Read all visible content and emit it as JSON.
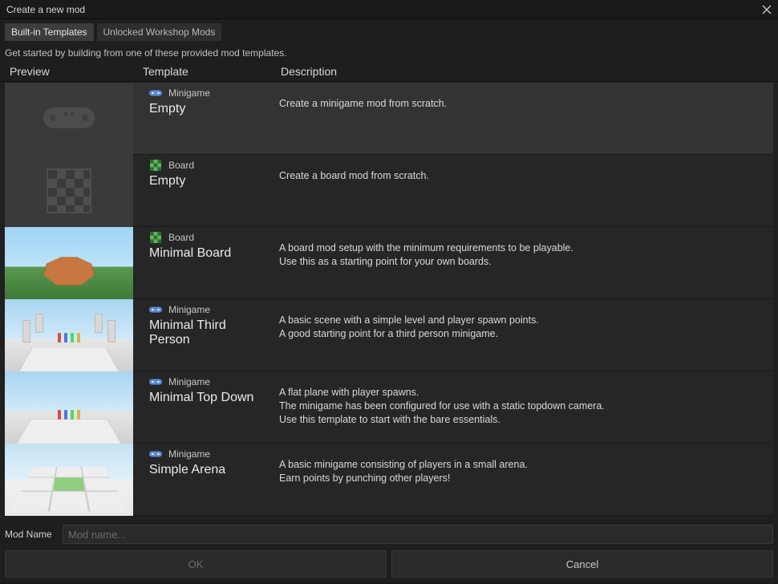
{
  "title": "Create a new mod",
  "tabs": {
    "builtin": "Built-in Templates",
    "workshop": "Unlocked Workshop Mods"
  },
  "instructions": "Get started by building from one of these provided mod templates.",
  "columns": {
    "preview": "Preview",
    "template": "Template",
    "description": "Description"
  },
  "type_labels": {
    "minigame": "Minigame",
    "board": "Board"
  },
  "templates": [
    {
      "type": "minigame",
      "name": "Empty",
      "description": "Create a minigame mod from scratch."
    },
    {
      "type": "board",
      "name": "Empty",
      "description": "Create a board mod from scratch."
    },
    {
      "type": "board",
      "name": "Minimal Board",
      "description": "A board mod setup with the minimum requirements to be playable.\nUse this as a starting point for your own boards."
    },
    {
      "type": "minigame",
      "name": "Minimal Third Person",
      "description": "A basic scene with a simple level and player spawn points.\nA good starting point for a third person minigame."
    },
    {
      "type": "minigame",
      "name": "Minimal Top Down",
      "description": "A flat plane with player spawns.\nThe minigame has been configured for use with a static topdown camera.\nUse this template to start with the bare essentials."
    },
    {
      "type": "minigame",
      "name": "Simple Arena",
      "description": "A basic minigame consisting of players in a small arena.\nEarn points by punching other players!"
    }
  ],
  "footer": {
    "mod_name_label": "Mod Name",
    "mod_name_placeholder": "Mod name...",
    "ok": "OK",
    "cancel": "Cancel"
  },
  "colors": {
    "minigame_icon": "#5a8dd6",
    "board_icon": "#5fb85f"
  }
}
